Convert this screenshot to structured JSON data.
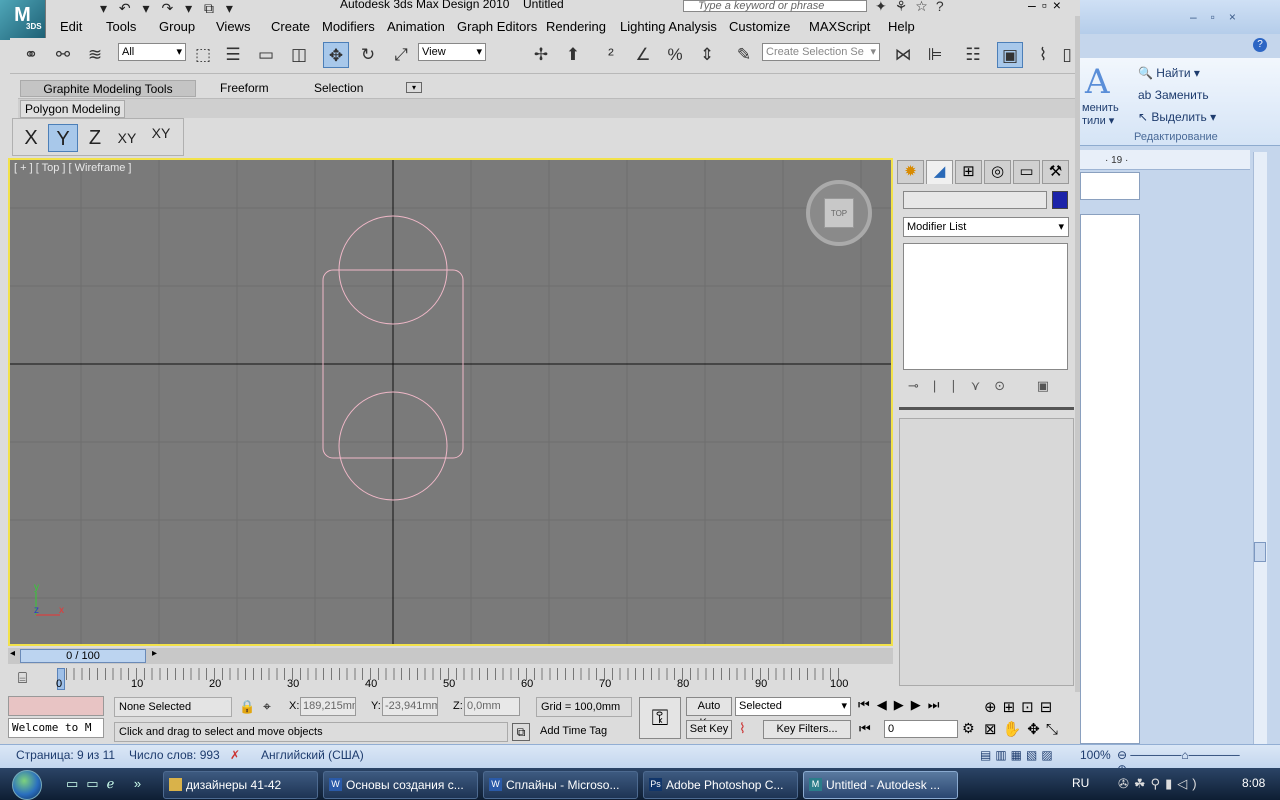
{
  "word": {
    "ribbon": {
      "find": "Найти",
      "replace": "Заменить",
      "select": "Выделить",
      "group": "Редактирование",
      "styles_1": "менить",
      "styles_2": "тили",
      "ruler_num": "· 19 ·"
    },
    "status": {
      "page": "Страница: 9 из 11",
      "words": "Число слов: 993",
      "language": "Английский (США)",
      "zoom": "100%"
    }
  },
  "max": {
    "app_title": "Autodesk 3ds Max Design 2010",
    "doc_title": "Untitled",
    "search_placeholder": "Type a keyword or phrase",
    "logo_text": "M",
    "logo_sub": "3DS",
    "menu": [
      "Edit",
      "Tools",
      "Group",
      "Views",
      "Create",
      "Modifiers",
      "Animation",
      "Graph Editors",
      "Rendering",
      "Lighting Analysis",
      "Customize",
      "MAXScript",
      "Help"
    ],
    "toolbar": {
      "filter": "All",
      "ref_coord": "View",
      "selection_set": "Create Selection Se"
    },
    "ribbon_tabs": [
      "Graphite Modeling Tools",
      "Freeform",
      "Selection"
    ],
    "ribbon_panel": "Polygon Modeling",
    "axis_buttons": [
      "X",
      "Y",
      "Z",
      "XY",
      "XY"
    ],
    "viewport": {
      "label": "[ + ] [ Top ] [ Wireframe ]",
      "viewcube": "TOP",
      "gizmo": {
        "x": "x",
        "y": "y",
        "z": "z"
      }
    },
    "command_panel": {
      "modifier_list": "Modifier List",
      "object_color": "#1a22a8"
    },
    "time": {
      "slider": "0 / 100",
      "ticks": [
        "0",
        "10",
        "20",
        "30",
        "40",
        "50",
        "60",
        "70",
        "80",
        "90",
        "100"
      ]
    },
    "status": {
      "welcome": "Welcome to M",
      "selection": "None Selected",
      "prompt": "Click and drag to select and move objects",
      "x_label": "X:",
      "x_value": "189,215mm",
      "y_label": "Y:",
      "y_value": "-23,941mm",
      "z_label": "Z:",
      "z_value": "0,0mm",
      "grid": "Grid = 100,0mm",
      "add_time_tag": "Add Time Tag",
      "auto_key": "Auto Key",
      "set_key": "Set Key",
      "key_mode": "Selected",
      "key_filters": "Key Filters...",
      "frame": "0"
    }
  },
  "taskbar": {
    "items": [
      {
        "label": "дизайнеры 41-42",
        "icon": "folder-icon"
      },
      {
        "label": "Основы создания с...",
        "icon": "word-doc-icon"
      },
      {
        "label": "Сплайны - Microso...",
        "icon": "word-doc-icon"
      },
      {
        "label": "Adobe Photoshop C...",
        "icon": "photoshop-icon"
      },
      {
        "label": "Untitled - Autodesk ...",
        "icon": "3dsmax-icon"
      }
    ],
    "language": "RU",
    "clock": "8:08"
  }
}
